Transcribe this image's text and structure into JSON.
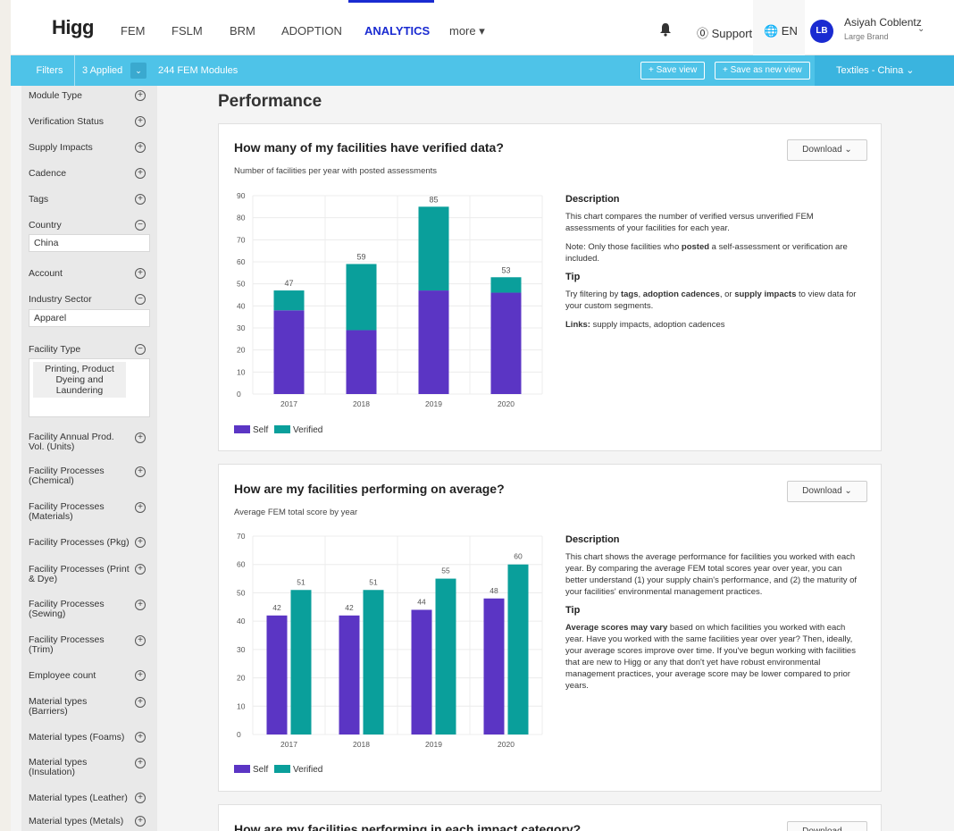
{
  "nav": {
    "logo": "Higg",
    "links": [
      "FEM",
      "FSLM",
      "BRM",
      "ADOPTION",
      "ANALYTICS",
      "more ▾"
    ],
    "active": "ANALYTICS",
    "support": "⓪ Support",
    "lang": "🌐 EN",
    "user": {
      "initials": "LB",
      "name": "Asiyah Coblentz",
      "role": "Large Brand"
    }
  },
  "filterbar": {
    "filters_label": "Filters",
    "applied": "3 Applied",
    "count": "244 FEM Modules",
    "save_view": "+  Save view",
    "save_new_view": "+  Save as new view",
    "region": "Textiles - China  ⌄"
  },
  "sidebar": {
    "module_type": "Module Type",
    "verification_status": "Verification Status",
    "supply_impacts": "Supply Impacts",
    "cadence": "Cadence",
    "tags": "Tags",
    "country": "Country",
    "country_value": "China",
    "account": "Account",
    "industry_sector": "Industry Sector",
    "industry_value": "Apparel",
    "facility_type": "Facility Type",
    "facility_type_value": "Printing, Product Dyeing and Laundering",
    "annual_prod": "Facility Annual Prod. Vol. (Units)",
    "proc_chemical": "Facility Processes (Chemical)",
    "proc_materials": "Facility Processes (Materials)",
    "proc_pkg": "Facility Processes (Pkg)",
    "proc_print": "Facility Processes (Print & Dye)",
    "proc_sewing": "Facility Processes (Sewing)",
    "proc_trim": "Facility Processes (Trim)",
    "employee_count": "Employee count",
    "mat_barriers": "Material types (Barriers)",
    "mat_foams": "Material types (Foams)",
    "mat_insulation": "Material types (Insulation)",
    "mat_leather": "Material types (Leather)",
    "mat_metals": "Material types (Metals)"
  },
  "main": {
    "title": "Performance",
    "download": "Download ⌄",
    "card1": {
      "title": "How many of my facilities have verified data?",
      "subtitle": "Number of facilities per year with posted assessments",
      "desc_heading": "Description",
      "desc_p1": "This chart compares the number of verified versus unverified FEM assessments of your facilities for each year.",
      "desc_p2_pre": "Note: Only those facilities who ",
      "desc_p2_bold": "posted",
      "desc_p2_post": " a self-assessment or verification are included.",
      "tip_heading": "Tip",
      "tip_pre": "Try filtering by ",
      "tip_b1": "tags",
      "tip_sep1": ", ",
      "tip_b2": "adoption cadences",
      "tip_sep2": ", or ",
      "tip_b3": "supply impacts",
      "tip_post": " to view data for your custom segments.",
      "links_label": "Links:",
      "links_text": " supply impacts, adoption cadences"
    },
    "card2": {
      "title": "How are my facilities performing on average?",
      "subtitle": "Average FEM total score by year",
      "desc_heading": "Description",
      "desc_p1": "This chart shows the average performance for facilities you worked with each year. By comparing the average FEM total scores year over year, you can better understand (1) your supply chain's performance, and (2) the maturity of your facilities' environmental management practices.",
      "tip_heading": "Tip",
      "tip_bold": "Average scores may vary",
      "tip_rest": " based on which facilities you worked with each year. Have you worked with the same facilities year over year? Then, ideally, your average scores improve over time. If you've begun working with facilities that are new to Higg or any that don't yet have robust environmental management practices, your average score may be lower compared to prior years."
    },
    "card3": {
      "title": "How are my facilities performing in each impact category?"
    }
  },
  "chart_data": [
    {
      "type": "bar",
      "stacked": true,
      "categories": [
        "2017",
        "2018",
        "2019",
        "2020"
      ],
      "series": [
        {
          "name": "Self",
          "values": [
            38,
            29,
            47,
            46
          ],
          "color": "#5b35c4"
        },
        {
          "name": "Verified",
          "values": [
            9,
            30,
            38,
            7
          ],
          "color": "#0a9f9b"
        }
      ],
      "totals": [
        47,
        59,
        85,
        53
      ],
      "ylim": [
        0,
        90
      ],
      "yticks": [
        0,
        10,
        20,
        30,
        40,
        50,
        60,
        70,
        80,
        90
      ],
      "grid": true,
      "legend": "bottom-left"
    },
    {
      "type": "bar",
      "stacked": false,
      "categories": [
        "2017",
        "2018",
        "2019",
        "2020"
      ],
      "series": [
        {
          "name": "Self",
          "values": [
            42,
            42,
            44,
            48
          ],
          "color": "#5b35c4"
        },
        {
          "name": "Verified",
          "values": [
            51,
            51,
            55,
            60
          ],
          "color": "#0a9f9b"
        }
      ],
      "ylim": [
        0,
        70
      ],
      "yticks": [
        0,
        10,
        20,
        30,
        40,
        50,
        60,
        70
      ],
      "grid": true,
      "legend": "bottom-left"
    }
  ]
}
